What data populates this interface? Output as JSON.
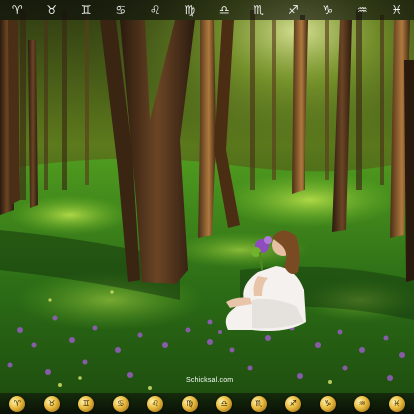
{
  "zodiac_bar": {
    "signs": [
      {
        "name": "aries",
        "glyph": "♈"
      },
      {
        "name": "taurus",
        "glyph": "♉"
      },
      {
        "name": "gemini",
        "glyph": "♊"
      },
      {
        "name": "cancer",
        "glyph": "♋"
      },
      {
        "name": "leo",
        "glyph": "♌"
      },
      {
        "name": "virgo",
        "glyph": "♍"
      },
      {
        "name": "libra",
        "glyph": "♎"
      },
      {
        "name": "scorpio",
        "glyph": "♏"
      },
      {
        "name": "sagittarius",
        "glyph": "♐"
      },
      {
        "name": "capricorn",
        "glyph": "♑"
      },
      {
        "name": "aquarius",
        "glyph": "♒"
      },
      {
        "name": "pisces",
        "glyph": "♓"
      }
    ]
  },
  "watermark": {
    "text": "Schicksal.com"
  },
  "badge_bar": {
    "badges": [
      {
        "name": "aries-badge-icon",
        "glyph": "♈"
      },
      {
        "name": "taurus-badge-icon",
        "glyph": "♉"
      },
      {
        "name": "gemini-badge-icon",
        "glyph": "♊"
      },
      {
        "name": "cancer-badge-icon",
        "glyph": "♋"
      },
      {
        "name": "leo-badge-icon",
        "glyph": "♌"
      },
      {
        "name": "virgo-badge-icon",
        "glyph": "♍"
      },
      {
        "name": "libra-badge-icon",
        "glyph": "♎"
      },
      {
        "name": "scorpio-badge-icon",
        "glyph": "♏"
      },
      {
        "name": "sagittarius-badge-icon",
        "glyph": "♐"
      },
      {
        "name": "capricorn-badge-icon",
        "glyph": "♑"
      },
      {
        "name": "aquarius-badge-icon",
        "glyph": "♒"
      },
      {
        "name": "pisces-badge-icon",
        "glyph": "♓"
      }
    ]
  },
  "colors": {
    "grass": "#3f8a1c",
    "sunlit_grass": "#a6d437",
    "shadow": "#0f2a0c",
    "dress": "#f4f1ee",
    "flowers": "#9a5cc4",
    "badge_gold": "#e8b93a"
  }
}
